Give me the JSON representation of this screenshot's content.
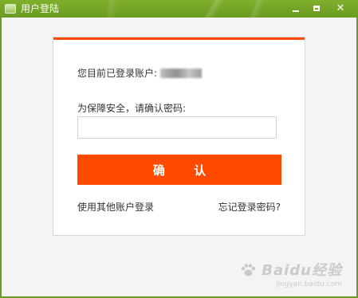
{
  "window": {
    "title": "用户登陆",
    "colors": {
      "titlebar": "#6b9a22",
      "accent": "#ff4a00",
      "background": "#f4f4f4"
    },
    "controls": {
      "minimize_icon": "minimize-icon",
      "maximize_icon": "maximize-icon",
      "close_icon": "close-icon",
      "close_glyph": "✕"
    }
  },
  "login": {
    "current_account_label": "您目前已登录账户:",
    "confirm_prompt": "为保障安全，请确认密码:",
    "password": {
      "value": "",
      "placeholder": ""
    },
    "confirm_button": "确 认",
    "other_account_link": "使用其他账户登录",
    "forgot_password_link": "忘记登录密码?"
  },
  "watermark": {
    "brand": "Baidu经验",
    "url": "jingyan.baidu.com"
  }
}
